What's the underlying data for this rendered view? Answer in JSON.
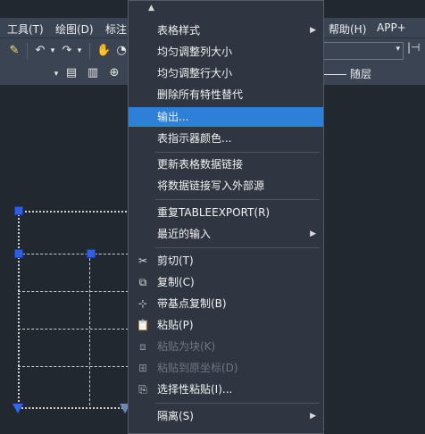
{
  "menubar": {
    "items": [
      "工具(T)",
      "绘图(D)",
      "标注",
      "帮助(H)",
      "APP+"
    ]
  },
  "toolbar": {
    "undo_glyph": "↶",
    "redo_glyph": "↷",
    "pan_glyph": "✋",
    "arrow_glyph": "▾"
  },
  "layer": {
    "label": "随层"
  },
  "context_menu": {
    "scroll_up": "▲",
    "items": [
      {
        "label": "表格样式",
        "submenu": "▶"
      },
      {
        "label": "均匀调整列大小"
      },
      {
        "label": "均匀调整行大小"
      },
      {
        "label": "删除所有特性替代"
      },
      {
        "label": "输出..."
      },
      {
        "label": "表指示器颜色..."
      },
      {
        "label": "更新表格数据链接"
      },
      {
        "label": "将数据链接写入外部源"
      },
      {
        "label": "重复TABLEEXPORT(R)"
      },
      {
        "label": "最近的输入",
        "submenu": "▶"
      },
      {
        "label": "剪切(T)",
        "icon": "✂"
      },
      {
        "label": "复制(C)",
        "icon": "⧉"
      },
      {
        "label": "带基点复制(B)",
        "icon": "⊹"
      },
      {
        "label": "粘贴(P)",
        "icon": "📋"
      },
      {
        "label": "粘贴为块(K)",
        "icon": "⧈"
      },
      {
        "label": "粘贴到原坐标(D)",
        "icon": "⊞"
      },
      {
        "label": "选择性粘贴(I)...",
        "icon": "⎘"
      },
      {
        "label": "隔离(S)",
        "submenu": "▶"
      }
    ]
  }
}
